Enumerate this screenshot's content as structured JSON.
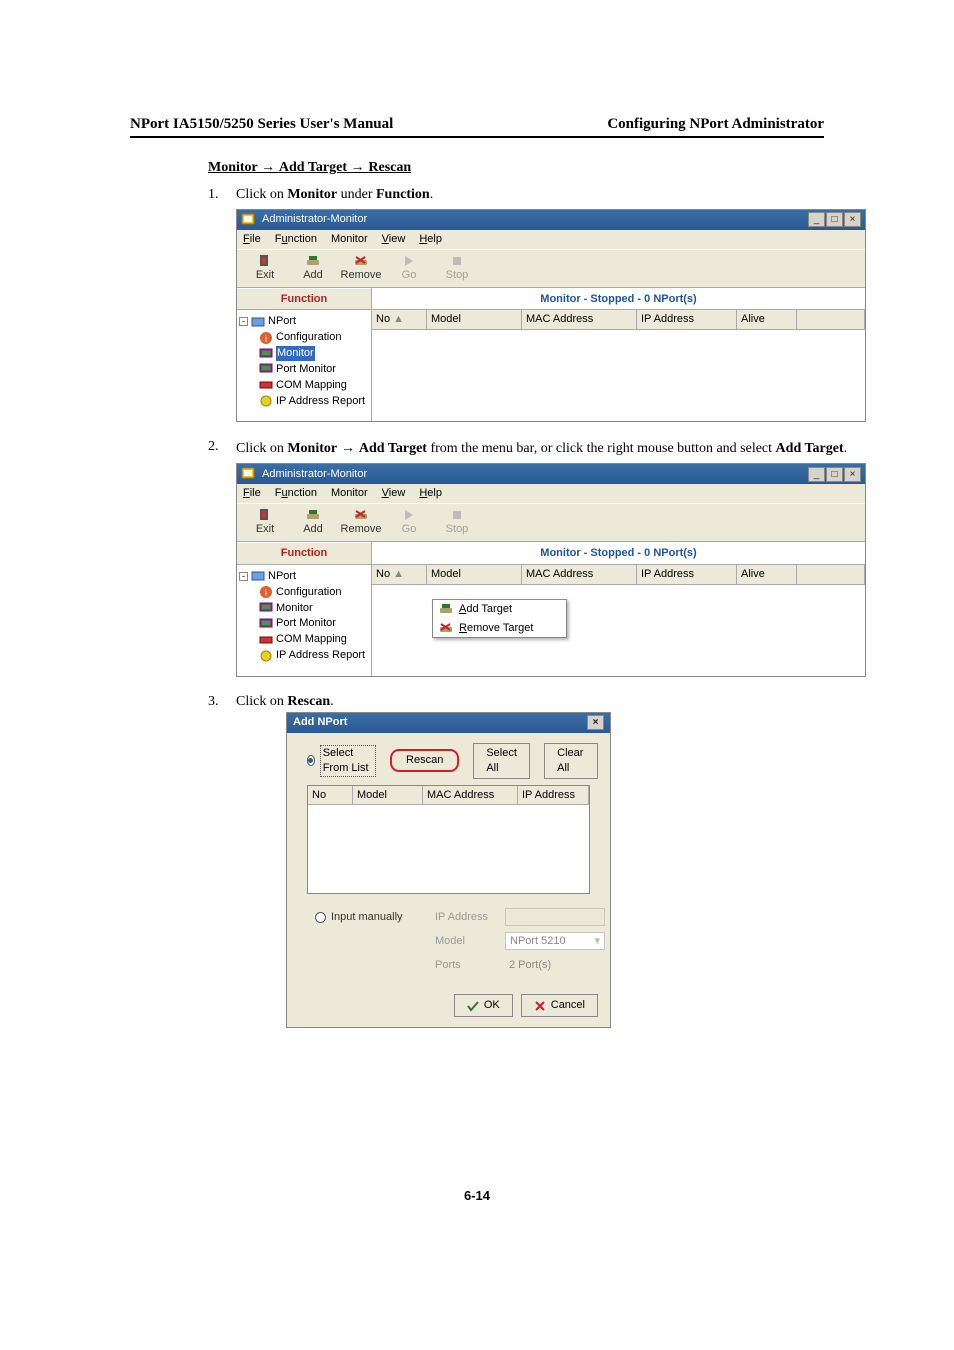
{
  "header": {
    "left": "NPort IA5150/5250 Series User's Manual",
    "right": "Configuring NPort Administrator"
  },
  "section": {
    "monitor_label": "Monitor",
    "add_target_label": "Add Target",
    "rescan_label": "Rescan"
  },
  "steps": {
    "s1_num": "1.",
    "s1_a": "Click on ",
    "s1_b": "Monitor",
    "s1_c": " under ",
    "s1_d": "Function",
    "s1_e": ".",
    "s2_num": "2.",
    "s2_a": "Click on ",
    "s2_b": "Monitor",
    "s2_arrow": " → ",
    "s2_c": "Add Target",
    "s2_d": " from the menu bar, or click the right mouse button and select ",
    "s2_e": "Add Target",
    "s2_f": ".",
    "s3_num": "3.",
    "s3_a": "Click on ",
    "s3_b": "Rescan",
    "s3_c": "."
  },
  "win": {
    "title": "Administrator-Monitor",
    "menu": {
      "file": "File",
      "function": "Function",
      "monitor": "Monitor",
      "view": "View",
      "help": "Help"
    },
    "toolbar": {
      "exit": "Exit",
      "add": "Add",
      "remove": "Remove",
      "go": "Go",
      "stop": "Stop"
    },
    "function_hdr": "Function",
    "status": "Monitor - Stopped - 0 NPort(s)",
    "tree": {
      "root": "NPort",
      "items": [
        "Configuration",
        "Monitor",
        "Port Monitor",
        "COM Mapping",
        "IP Address Report"
      ]
    },
    "cols": {
      "no": "No",
      "model": "Model",
      "mac": "MAC Address",
      "ip": "IP Address",
      "alive": "Alive"
    },
    "ctx": {
      "add": "Add Target",
      "remove": "Remove Target"
    }
  },
  "dlg": {
    "title": "Add NPort",
    "select_from_list": "Select From List",
    "rescan": "Rescan",
    "select_all": "Select All",
    "clear_all": "Clear All",
    "cols": {
      "no": "No",
      "model": "Model",
      "mac": "MAC Address",
      "ip": "IP Address"
    },
    "input_manually": "Input manually",
    "ip_label": "IP Address",
    "model_label": "Model",
    "ports_label": "Ports",
    "model_val": "NPort 5210",
    "ports_val": "2 Port(s)",
    "ok": "OK",
    "cancel": "Cancel"
  },
  "footer": "6-14"
}
